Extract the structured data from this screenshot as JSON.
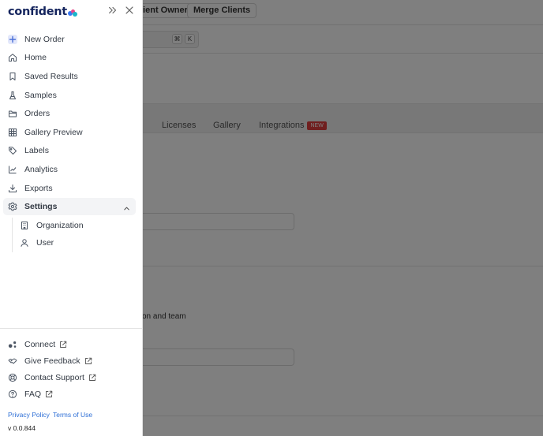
{
  "background": {
    "top_buttons": [
      "lient Owner",
      "Merge Clients"
    ],
    "search_shortcut": [
      "⌘",
      "K"
    ],
    "tabs": [
      {
        "label": "Licenses"
      },
      {
        "label": "Gallery"
      },
      {
        "label": "Integrations",
        "badge": "NEW"
      }
    ],
    "section_text": "on and team"
  },
  "sidebar": {
    "logo": "confident",
    "logo_dot_colors": [
      "#3a78f2",
      "#e8478b",
      "#19b7c9"
    ],
    "nav": [
      {
        "label": "New Order",
        "icon": "plus-icon"
      },
      {
        "label": "Home",
        "icon": "home-icon"
      },
      {
        "label": "Saved Results",
        "icon": "bookmark-icon"
      },
      {
        "label": "Samples",
        "icon": "flask-icon"
      },
      {
        "label": "Orders",
        "icon": "folder-icon"
      },
      {
        "label": "Gallery Preview",
        "icon": "grid-icon"
      },
      {
        "label": "Labels",
        "icon": "tag-icon"
      },
      {
        "label": "Analytics",
        "icon": "chart-icon"
      },
      {
        "label": "Exports",
        "icon": "download-icon"
      },
      {
        "label": "Settings",
        "icon": "gear-icon",
        "expanded": true
      }
    ],
    "settings_sub": [
      {
        "label": "Organization",
        "icon": "building-icon"
      },
      {
        "label": "User",
        "icon": "user-icon"
      }
    ],
    "footer": [
      {
        "label": "Connect",
        "icon": "users-icon"
      },
      {
        "label": "Give Feedback",
        "icon": "handshake-icon"
      },
      {
        "label": "Contact Support",
        "icon": "lifebuoy-icon"
      },
      {
        "label": "FAQ",
        "icon": "help-circle-icon"
      }
    ],
    "privacy": "Privacy Policy",
    "terms": "Terms of Use",
    "version": "v 0.0.844"
  },
  "colors": {
    "accent_link": "#2e6fd6",
    "new_badge": "#e03e3e",
    "new_order_icon_bg": "#e3e8fb"
  }
}
